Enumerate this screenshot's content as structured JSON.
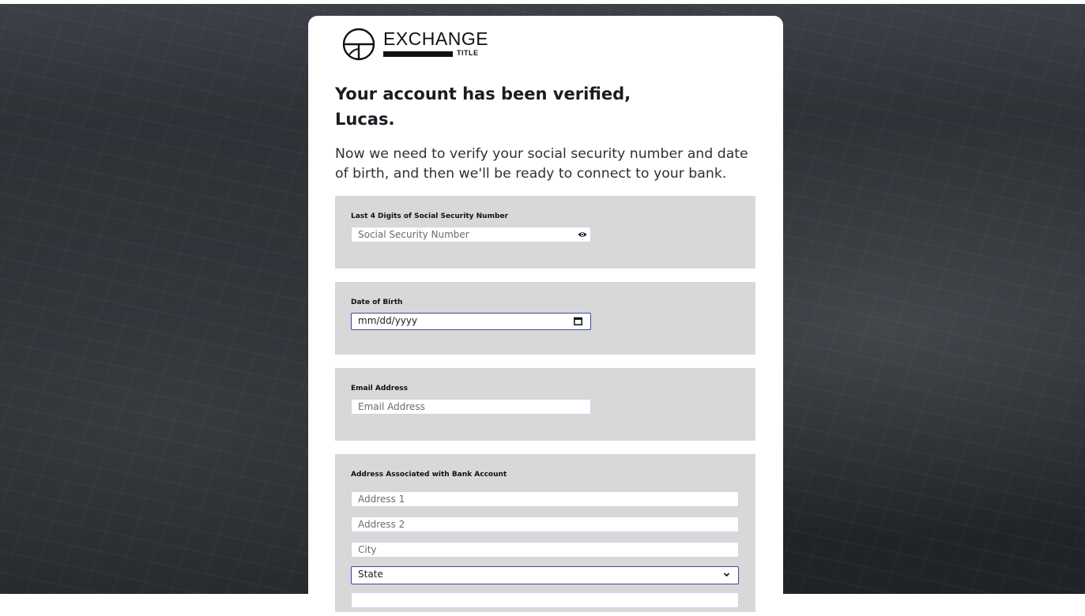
{
  "brand": {
    "logo_text": "EXCHANGE",
    "logo_sub": "TITLE"
  },
  "heading": {
    "line1": "Your account has been verified,",
    "line2": "Lucas."
  },
  "intro": {
    "line1": "Now we need to verify your social security number and date",
    "line2": "of birth, and then we'll be ready to connect to your bank."
  },
  "ssn": {
    "label": "Last 4 Digits of Social Security Number",
    "placeholder": "Social Security Number",
    "icon": "eye-icon"
  },
  "dob": {
    "label": "Date of Birth",
    "placeholder": "mm/dd/yyyy",
    "icon": "calendar-icon"
  },
  "email": {
    "label": "Email Address",
    "placeholder": "Email Address"
  },
  "address": {
    "label": "Address Associated with Bank Account",
    "address1_placeholder": "Address 1",
    "address2_placeholder": "Address 2",
    "city_placeholder": "City",
    "state_value": "State",
    "state_icon": "chevron-down-icon"
  },
  "colors": {
    "section_bg": "#d8d8d8",
    "focus_border": "#3a4aa3",
    "text_dark": "#1b1b22"
  }
}
